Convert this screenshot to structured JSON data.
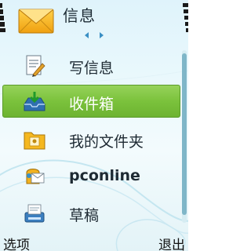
{
  "header": {
    "title": "信息",
    "app_icon": "envelope-icon"
  },
  "list": {
    "items": [
      {
        "label": "写信息",
        "icon": "write-message-icon",
        "selected": false
      },
      {
        "label": "收件箱",
        "icon": "inbox-icon",
        "selected": true
      },
      {
        "label": "我的文件夹",
        "icon": "folder-icon",
        "selected": false
      },
      {
        "label": "pconline",
        "icon": "mailbox-icon",
        "selected": false
      },
      {
        "label": "草稿",
        "icon": "drafts-icon",
        "selected": false
      }
    ]
  },
  "softkeys": {
    "left": "选项",
    "right": "退出"
  },
  "colors": {
    "highlight": "#7bc23c",
    "background": "#e9f8fc",
    "accent": "#3a8fc4"
  }
}
